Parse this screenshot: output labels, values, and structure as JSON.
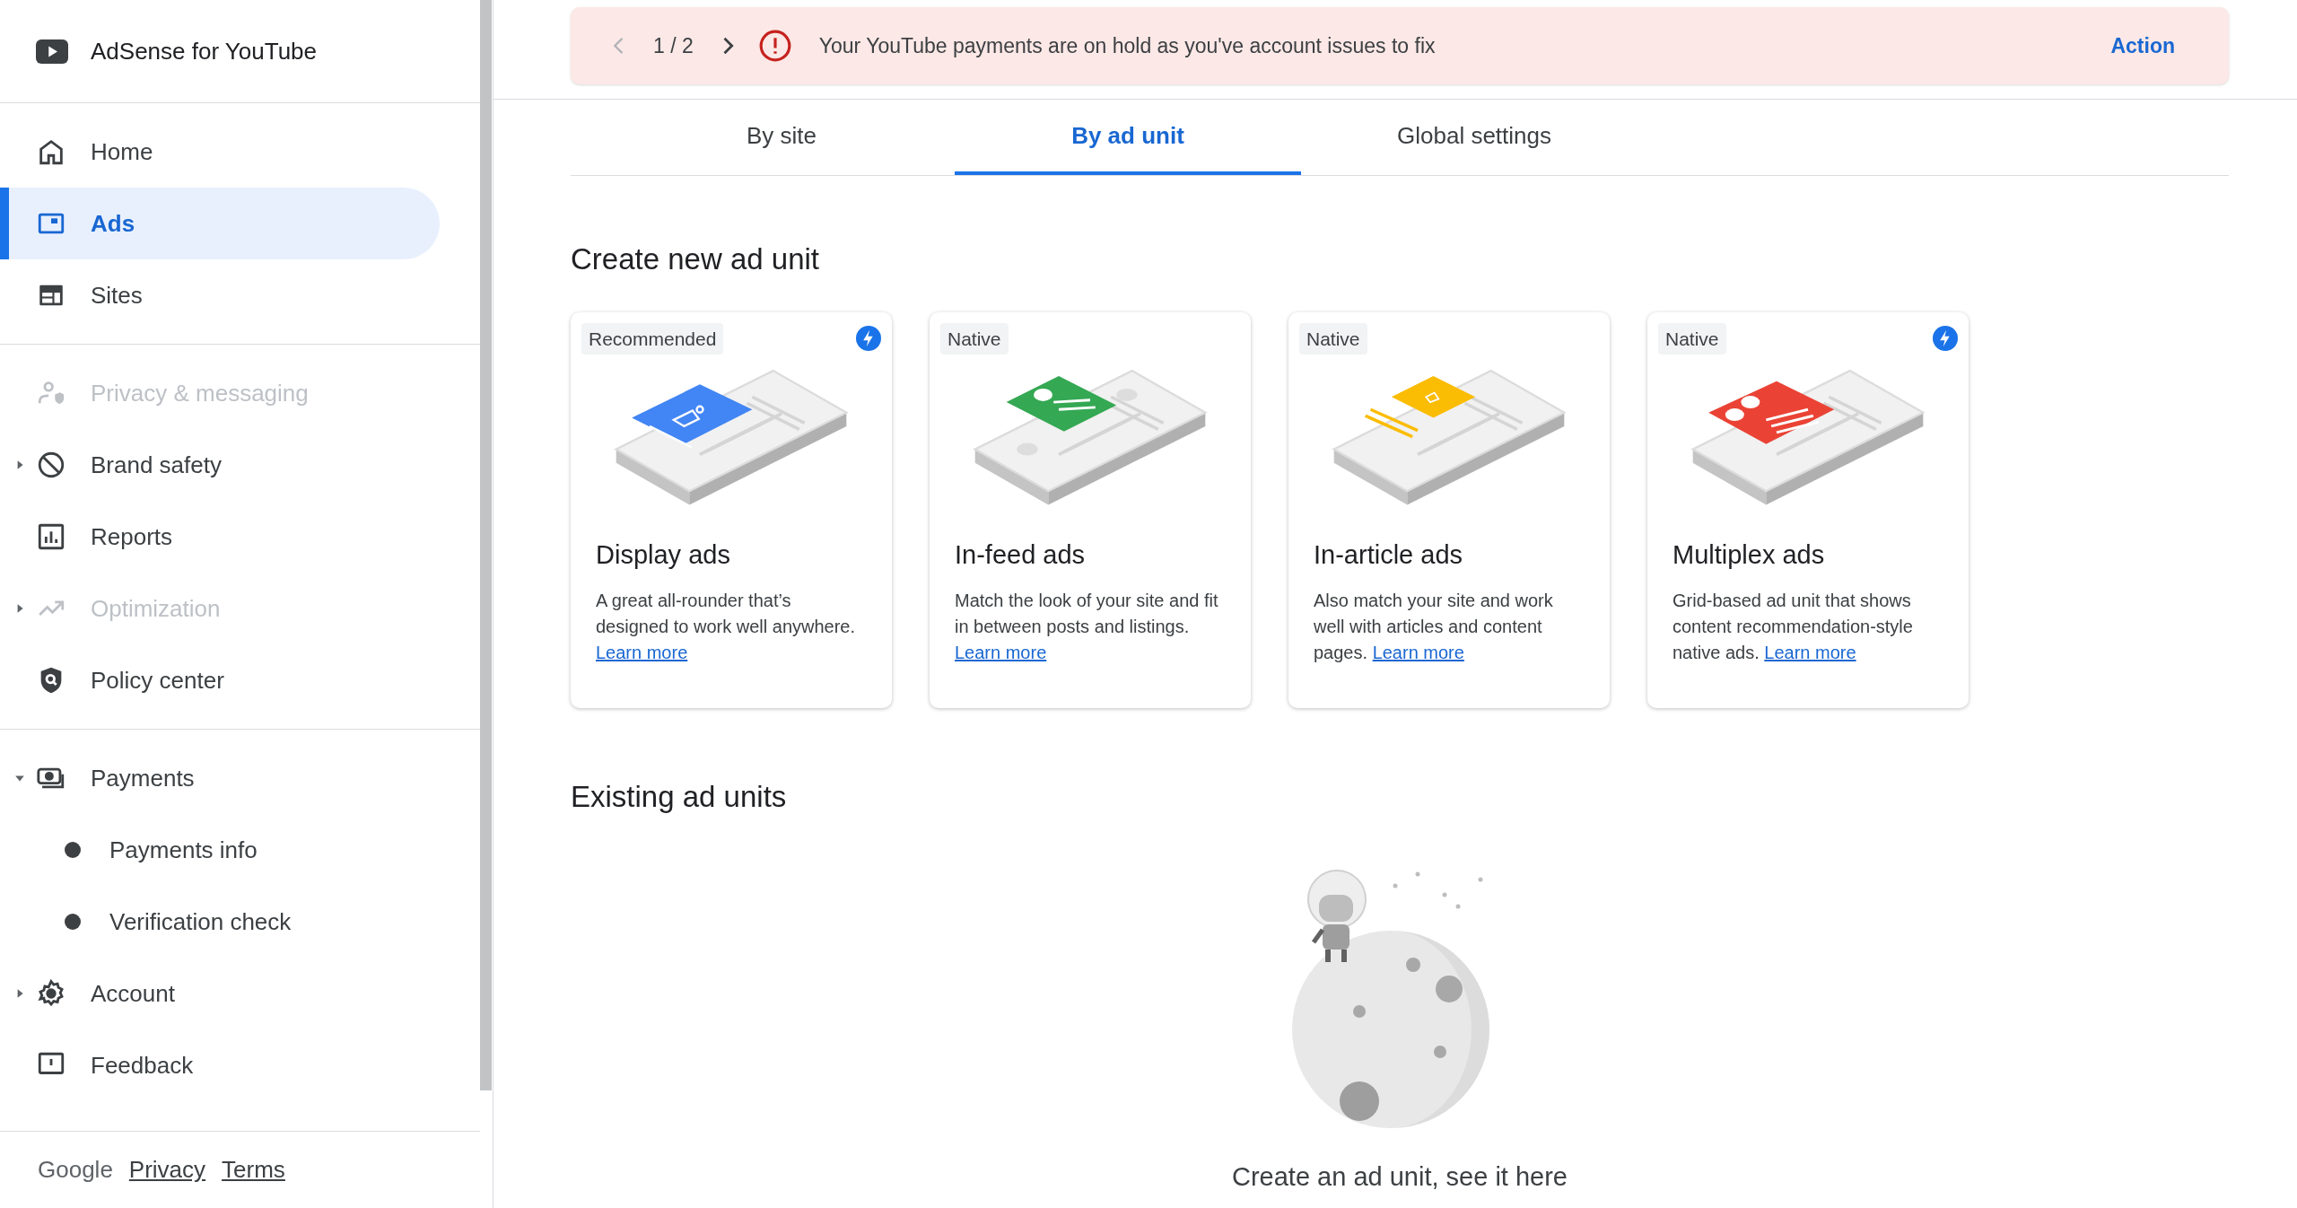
{
  "sidebar": {
    "brand": "AdSense for YouTube",
    "groups": [
      [
        {
          "label": "Home",
          "selected": false,
          "disabled": false
        },
        {
          "label": "Ads",
          "selected": true,
          "disabled": false
        },
        {
          "label": "Sites",
          "selected": false,
          "disabled": false
        }
      ],
      [
        {
          "label": "Privacy & messaging",
          "selected": false,
          "disabled": true
        },
        {
          "label": "Brand safety",
          "selected": false,
          "disabled": false,
          "expanded": false
        },
        {
          "label": "Reports",
          "selected": false,
          "disabled": false
        },
        {
          "label": "Optimization",
          "selected": false,
          "disabled": true,
          "expanded": false
        },
        {
          "label": "Policy center",
          "selected": false,
          "disabled": false
        }
      ],
      [
        {
          "label": "Payments",
          "selected": false,
          "disabled": false,
          "expanded": true,
          "children": [
            {
              "label": "Payments info",
              "selected": false
            },
            {
              "label": "Verification check",
              "selected": false
            }
          ]
        },
        {
          "label": "Account",
          "selected": false,
          "disabled": false,
          "expanded": false
        },
        {
          "label": "Feedback",
          "selected": false,
          "disabled": false
        }
      ]
    ],
    "footer": {
      "brand": "Google",
      "links": [
        "Privacy",
        "Terms"
      ]
    }
  },
  "banner": {
    "pager": "1 / 2",
    "prev_disabled": true,
    "message": "Your YouTube payments are on hold as you've account issues to fix",
    "action": "Action"
  },
  "tabs": [
    {
      "label": "By site",
      "selected": false
    },
    {
      "label": "By ad unit",
      "selected": true
    },
    {
      "label": "Global settings",
      "selected": false
    }
  ],
  "create_section": {
    "title": "Create new ad unit",
    "cards": [
      {
        "kind": "display",
        "badge": "Recommended",
        "flash": true,
        "title": "Display ads",
        "description": "A great all-rounder that’s designed to work well anywhere.",
        "link": "Learn more"
      },
      {
        "kind": "infeed",
        "badge": "Native",
        "flash": false,
        "title": "In-feed ads",
        "description": "Match the look of your site and fit in between posts and listings.",
        "link": "Learn more"
      },
      {
        "kind": "inarticle",
        "badge": "Native",
        "flash": false,
        "title": "In-article ads",
        "description": "Also match your site and work well with articles and content pages.",
        "link": "Learn more"
      },
      {
        "kind": "multiplex",
        "badge": "Native",
        "flash": true,
        "title": "Multiplex ads",
        "description": "Grid-based ad unit that shows content recommendation-style native ads.",
        "link": "Learn more"
      }
    ]
  },
  "existing_section": {
    "title": "Existing ad units",
    "empty_text": "Create an ad unit, see it here"
  }
}
